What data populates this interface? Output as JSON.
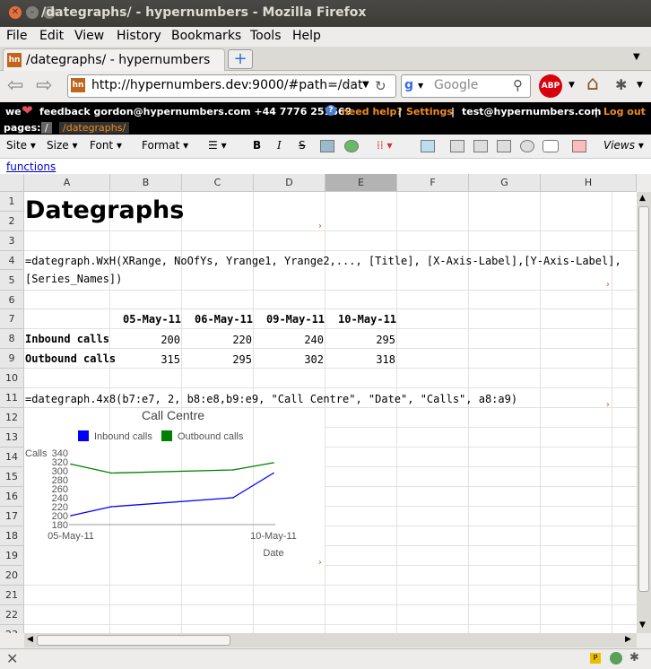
{
  "window": {
    "title": "/dategraphs/ - hypernumbers - Mozilla Firefox"
  },
  "menu": [
    "File",
    "Edit",
    "View",
    "History",
    "Bookmarks",
    "Tools",
    "Help"
  ],
  "tab": {
    "label": "/dategraphs/ - hypernumbers",
    "favicon": "hn"
  },
  "nav": {
    "url": "http://hypernumbers.dev:9000/#path=/dat",
    "search_placeholder": "Google",
    "adblock": "ABP"
  },
  "app_header": {
    "prefix": "we",
    "feedback": "feedback gordon@hypernumbers.com +44 7776 251669",
    "help": "need help?",
    "settings": "Settings",
    "user": "test@hypernumbers.com",
    "logout": "Log out",
    "pages_label": "pages:",
    "crumb_root": "/",
    "crumb_current": "/dategraphs/"
  },
  "toolbar": {
    "site": "Site",
    "size": "Size",
    "font": "Font",
    "format": "Format",
    "views": "Views"
  },
  "functions_link": "functions",
  "columns": [
    "A",
    "B",
    "C",
    "D",
    "E",
    "F",
    "G",
    "H"
  ],
  "rows": [
    "1",
    "2",
    "3",
    "4",
    "5",
    "6",
    "7",
    "8",
    "9",
    "10",
    "11",
    "12",
    "13",
    "14",
    "15",
    "16",
    "17",
    "18",
    "19",
    "20",
    "21",
    "22",
    "23"
  ],
  "cells": {
    "title": "Dategraphs",
    "formula_line1": "=dategraph.WxH(XRange, NoOfYs, Yrange1, Yrange2,..., [Title], [X-Axis-Label],[Y-Axis-Label],",
    "formula_line2": "[Series_Names])",
    "dates": [
      "05-May-11",
      "06-May-11",
      "09-May-11",
      "10-May-11"
    ],
    "inbound_label": "Inbound calls",
    "inbound_values": [
      "200",
      "220",
      "240",
      "295"
    ],
    "outbound_label": "Outbound calls",
    "outbound_values": [
      "315",
      "295",
      "302",
      "318"
    ],
    "formula_example": "=dategraph.4x8(b7:e7, 2, b8:e8,b9:e9, \"Call Centre\", \"Date\", \"Calls\", a8:a9)"
  },
  "chart_data": {
    "type": "line",
    "title": "Call Centre",
    "xlabel": "Date",
    "ylabel": "Calls",
    "x": [
      "05-May-11",
      "06-May-11",
      "09-May-11",
      "10-May-11"
    ],
    "x_tick_labels": [
      "05-May-11",
      "10-May-11"
    ],
    "y_ticks": [
      "180",
      "200",
      "220",
      "240",
      "260",
      "280",
      "300",
      "320",
      "340"
    ],
    "ylim": [
      180,
      340
    ],
    "legend_position": "top",
    "series": [
      {
        "name": "Inbound calls",
        "values": [
          200,
          220,
          240,
          295
        ],
        "color": "#0000ff"
      },
      {
        "name": "Outbound calls",
        "values": [
          315,
          295,
          302,
          318
        ],
        "color": "#008000"
      }
    ]
  }
}
